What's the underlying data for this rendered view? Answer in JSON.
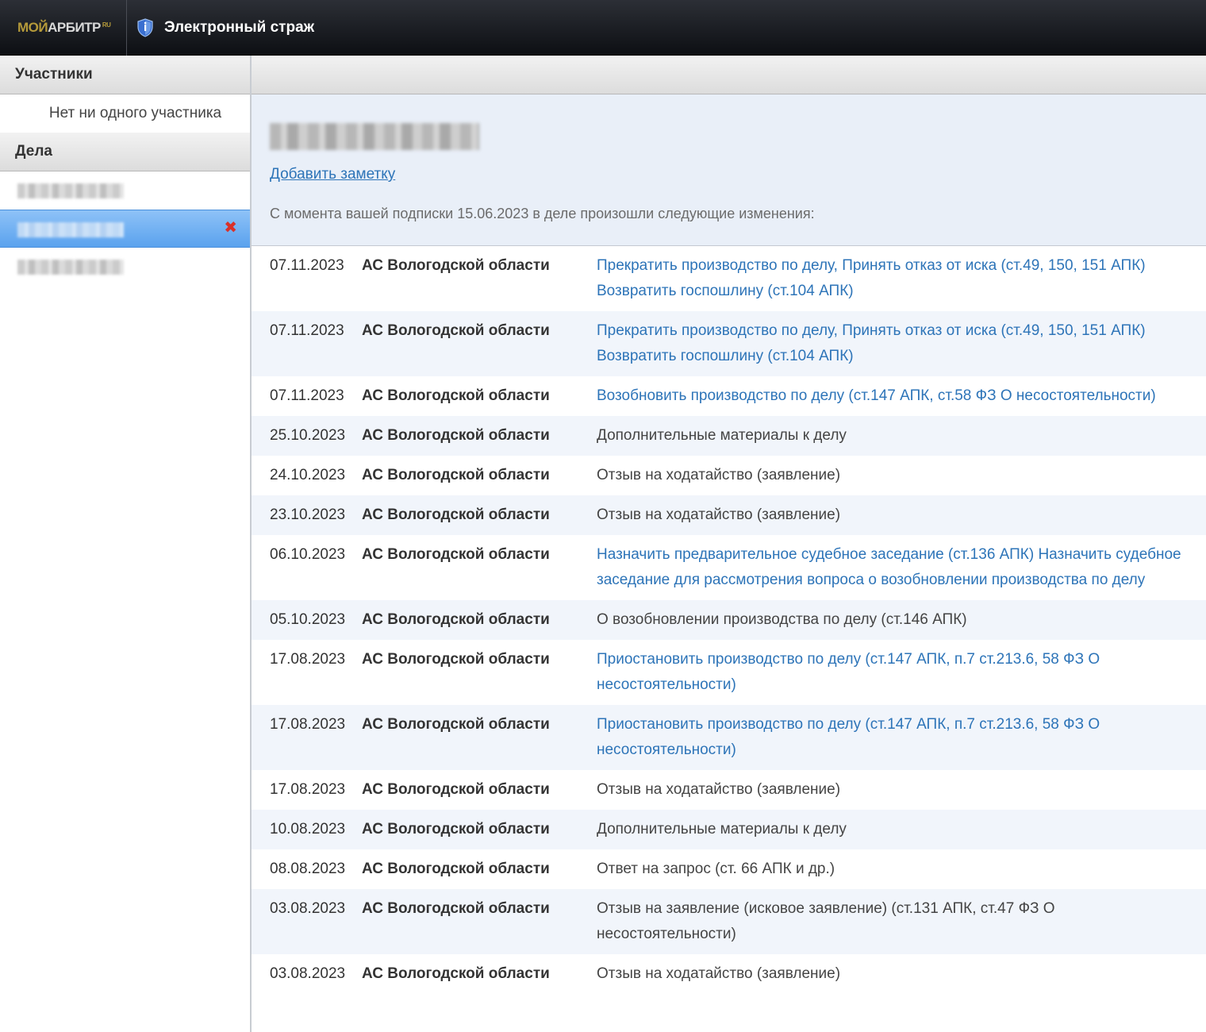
{
  "topbar": {
    "logo_part1": "МОЙ",
    "logo_part2": "АРБИТР",
    "logo_part3": "RU",
    "title": "Электронный страж",
    "icon": "shield-icon"
  },
  "sidebar": {
    "participants_header": "Участники",
    "no_participants": "Нет ни одного участника",
    "cases_header": "Дела",
    "remove_icon": "✖"
  },
  "main": {
    "add_note": "Добавить заметку",
    "since_text": "С момента вашей подписки 15.06.2023 в деле произошли следующие изменения:"
  },
  "events": [
    {
      "date": "07.11.2023",
      "court": "АС Вологодской области",
      "desc": "Прекратить производство по делу, Принять отказ от иска (ст.49, 150, 151 АПК) Возвратить госпошлину (ст.104 АПК)",
      "link": true
    },
    {
      "date": "07.11.2023",
      "court": "АС Вологодской области",
      "desc": "Прекратить производство по делу, Принять отказ от иска (ст.49, 150, 151 АПК) Возвратить госпошлину (ст.104 АПК)",
      "link": true
    },
    {
      "date": "07.11.2023",
      "court": "АС Вологодской области",
      "desc": "Возобновить производство по делу (ст.147 АПК, ст.58 ФЗ О несостоятельности)",
      "link": true
    },
    {
      "date": "25.10.2023",
      "court": "АС Вологодской области",
      "desc": "Дополнительные материалы к делу",
      "link": false
    },
    {
      "date": "24.10.2023",
      "court": "АС Вологодской области",
      "desc": "Отзыв на ходатайство (заявление)",
      "link": false
    },
    {
      "date": "23.10.2023",
      "court": "АС Вологодской области",
      "desc": "Отзыв на ходатайство (заявление)",
      "link": false
    },
    {
      "date": "06.10.2023",
      "court": "АС Вологодской области",
      "desc": "Назначить предварительное судебное заседание (ст.136 АПК) Назначить судебное заседание для рассмотрения вопроса о возобновлении производства по делу",
      "link": true
    },
    {
      "date": "05.10.2023",
      "court": "АС Вологодской области",
      "desc": "О возобновлении производства по делу (ст.146 АПК)",
      "link": false
    },
    {
      "date": "17.08.2023",
      "court": "АС Вологодской области",
      "desc": "Приостановить производство по делу (ст.147 АПК, п.7 ст.213.6, 58 ФЗ О несостоятельности)",
      "link": true
    },
    {
      "date": "17.08.2023",
      "court": "АС Вологодской области",
      "desc": "Приостановить производство по делу (ст.147 АПК, п.7 ст.213.6, 58 ФЗ О несостоятельности)",
      "link": true
    },
    {
      "date": "17.08.2023",
      "court": "АС Вологодской области",
      "desc": "Отзыв на ходатайство (заявление)",
      "link": false
    },
    {
      "date": "10.08.2023",
      "court": "АС Вологодской области",
      "desc": "Дополнительные материалы к делу",
      "link": false
    },
    {
      "date": "08.08.2023",
      "court": "АС Вологодской области",
      "desc": "Ответ на запрос (ст. 66 АПК и др.)",
      "link": false
    },
    {
      "date": "03.08.2023",
      "court": "АС Вологодской области",
      "desc": "Отзыв на заявление (исковое заявление) (ст.131 АПК, ст.47 ФЗ О несостоятельности)",
      "link": false
    },
    {
      "date": "03.08.2023",
      "court": "АС Вологодской области",
      "desc": "Отзыв на ходатайство (заявление)",
      "link": false
    }
  ]
}
